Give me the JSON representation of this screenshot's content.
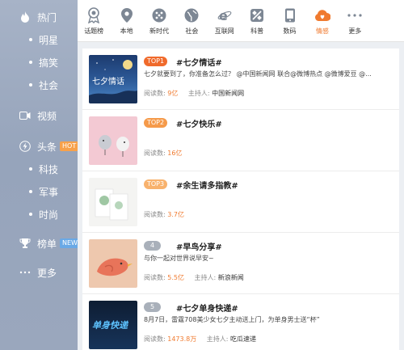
{
  "sidebar": {
    "items": [
      {
        "label": "热门",
        "icon": "flame-icon"
      },
      {
        "label": "明星"
      },
      {
        "label": "搞笑"
      },
      {
        "label": "社会"
      },
      {
        "label": "视频",
        "icon": "video-icon"
      },
      {
        "label": "头条",
        "icon": "lightning-icon",
        "badge": "HOT"
      },
      {
        "label": "科技"
      },
      {
        "label": "军事"
      },
      {
        "label": "时尚"
      },
      {
        "label": "榜单",
        "icon": "trophy-icon",
        "badge": "NEW"
      },
      {
        "label": "更多",
        "icon": "more-dots-icon"
      }
    ]
  },
  "topnav": {
    "active": "情感",
    "accent": "#f07a2f",
    "items": [
      {
        "label": "话题榜",
        "icon": "topic-badge-icon"
      },
      {
        "label": "本地",
        "icon": "location-pin-icon"
      },
      {
        "label": "新时代",
        "icon": "star-dots-icon"
      },
      {
        "label": "社会",
        "icon": "globe-icon"
      },
      {
        "label": "互联网",
        "icon": "browser-e-icon"
      },
      {
        "label": "科普",
        "icon": "satellite-icon"
      },
      {
        "label": "数码",
        "icon": "phone-icon"
      },
      {
        "label": "情感",
        "icon": "heart-cloud-icon"
      },
      {
        "label": "更多",
        "icon": "more-dots-icon"
      }
    ]
  },
  "meta_labels": {
    "reads": "阅读数:",
    "host": "主持人:"
  },
  "topics": [
    {
      "rank": "TOP1",
      "title": "#七夕情话#",
      "desc": "七夕就要到了，你准备怎么过？ @中国新闻网 联合@微博热点 @微博爱豆 @...",
      "reads": "9亿",
      "host": "中国新闻网",
      "thumb_text": "七夕情话"
    },
    {
      "rank": "TOP2",
      "title": "#七夕快乐#",
      "desc": "",
      "reads": "16亿",
      "host": ""
    },
    {
      "rank": "TOP3",
      "title": "#余生请多指教#",
      "desc": "",
      "reads": "3.7亿",
      "host": ""
    },
    {
      "rank": "4",
      "title": "#早鸟分享#",
      "desc": "与你一起对世界说早安~",
      "reads": "5.5亿",
      "host": "新浪新闻"
    },
    {
      "rank": "5",
      "title": "#七夕单身快递#",
      "desc": "8月7日，雷霆708美少女七夕主动送上门，为单身男士送“杯”",
      "reads": "1473.8万",
      "host": "吃瓜速递",
      "thumb_text": "单身快递"
    }
  ]
}
